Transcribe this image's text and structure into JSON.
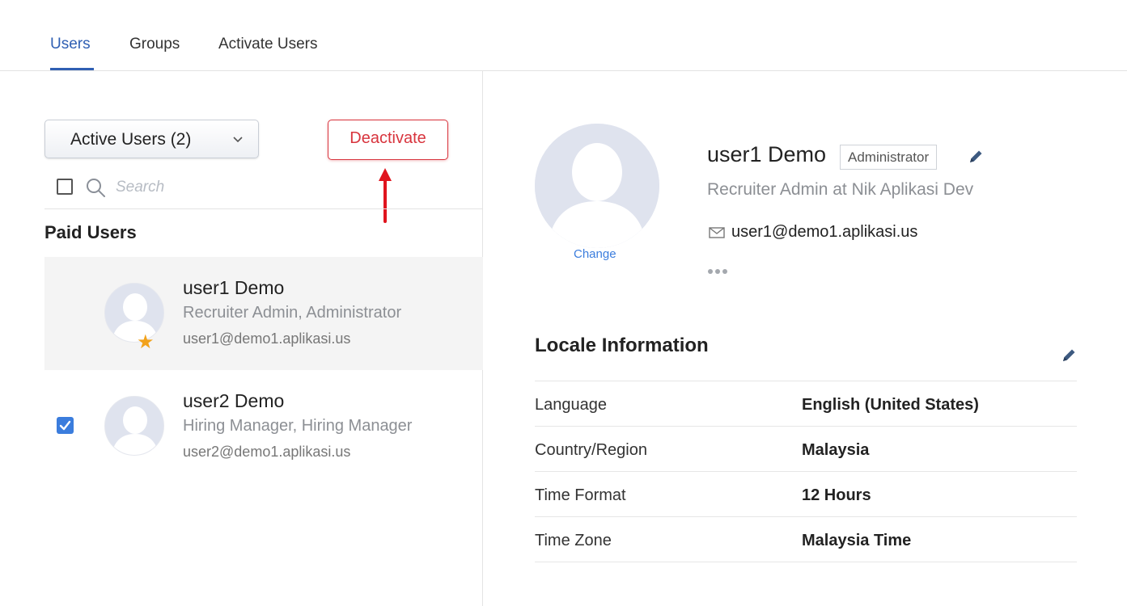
{
  "tabs": [
    {
      "label": "Users"
    },
    {
      "label": "Groups"
    },
    {
      "label": "Activate Users"
    }
  ],
  "filter": {
    "label": "Active Users (2)"
  },
  "toolbar": {
    "deactivate_label": "Deactivate",
    "arrow_color": "#e0141e"
  },
  "search": {
    "placeholder": "Search",
    "value": ""
  },
  "section": {
    "title": "Paid Users"
  },
  "users": [
    {
      "name": "user1 Demo",
      "role": "Recruiter Admin, Administrator",
      "email": "user1@demo1.aplikasi.us",
      "checked": false,
      "starred": true,
      "star": "★"
    },
    {
      "name": "user2 Demo",
      "role": "Hiring Manager, Hiring Manager",
      "email": "user2@demo1.aplikasi.us",
      "checked": true,
      "starred": false
    }
  ],
  "profile": {
    "name": "user1 Demo",
    "badge": "Administrator",
    "title": "Recruiter Admin at Nik Aplikasi Dev",
    "email": "user1@demo1.aplikasi.us",
    "change_label": "Change"
  },
  "locale": {
    "title": "Locale Information",
    "rows": [
      {
        "label": "Language",
        "value": "English (United States)"
      },
      {
        "label": "Country/Region",
        "value": "Malaysia"
      },
      {
        "label": "Time Format",
        "value": "12 Hours"
      },
      {
        "label": "Time Zone",
        "value": "Malaysia Time"
      }
    ]
  },
  "colors": {
    "accent": "#2f5fb3",
    "danger": "#d8343d",
    "link": "#3b7ddd",
    "star": "#f2a21b"
  }
}
